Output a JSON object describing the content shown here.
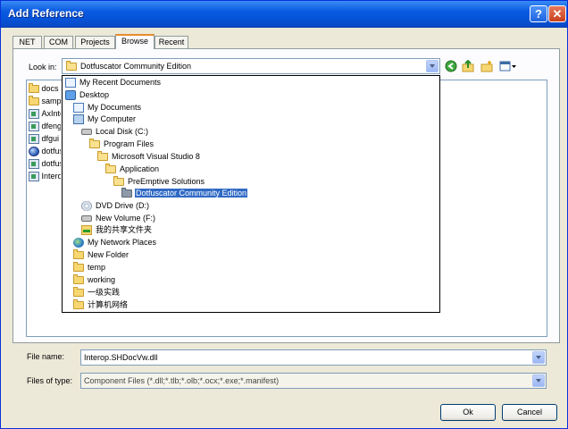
{
  "window": {
    "title": "Add Reference",
    "help_label": "?",
    "close_label": "✕"
  },
  "tabs": [
    {
      "label": "NET"
    },
    {
      "label": "COM"
    },
    {
      "label": "Projects"
    },
    {
      "label": "Browse",
      "active": true
    },
    {
      "label": "Recent"
    }
  ],
  "lookin": {
    "label": "Look in:",
    "value": "Dotfuscator Community Edition"
  },
  "toolbar": {
    "icons": [
      "back-icon",
      "up-folder-icon",
      "new-folder-icon",
      "view-menu-icon"
    ]
  },
  "files": [
    {
      "label": "docs",
      "icon": "folder"
    },
    {
      "label": "samples",
      "icon": "folder"
    },
    {
      "label": "AxInterop",
      "icon": "dll"
    },
    {
      "label": "dfeng",
      "icon": "dll"
    },
    {
      "label": "dfgui",
      "icon": "dll"
    },
    {
      "label": "dotfuscator",
      "icon": "globe"
    },
    {
      "label": "dotfuscator",
      "icon": "dll"
    },
    {
      "label": "Interop",
      "icon": "dll"
    }
  ],
  "location_dropdown": [
    {
      "label": "My Recent Documents",
      "icon": "doc"
    },
    {
      "label": "Desktop",
      "icon": "desk"
    },
    {
      "label": "My Documents",
      "icon": "doc"
    },
    {
      "label": "My Computer",
      "icon": "comp"
    },
    {
      "label": "Local Disk (C:)",
      "icon": "disk"
    },
    {
      "label": "Program Files",
      "icon": "folder-open"
    },
    {
      "label": "Microsoft Visual Studio 8",
      "icon": "folder-open"
    },
    {
      "label": "Application",
      "icon": "folder-open"
    },
    {
      "label": "PreEmptive Solutions",
      "icon": "folder-open"
    },
    {
      "label": "Dotfuscator Community Edition",
      "icon": "folder-gray",
      "selected": true
    },
    {
      "label": "DVD Drive (D:)",
      "icon": "dvd"
    },
    {
      "label": "New Volume (F:)",
      "icon": "disk"
    },
    {
      "label": "我的共享文件夹",
      "icon": "share"
    },
    {
      "label": "My Network Places",
      "icon": "net"
    },
    {
      "label": "New Folder",
      "icon": "folder"
    },
    {
      "label": "temp",
      "icon": "folder"
    },
    {
      "label": "working",
      "icon": "folder"
    },
    {
      "label": "一级实践",
      "icon": "folder"
    },
    {
      "label": "计算机网络",
      "icon": "folder"
    }
  ],
  "filename": {
    "label": "File name:",
    "value": "Interop.SHDocVw.dll"
  },
  "filetype": {
    "label": "Files of type:",
    "value": "Component Files (*.dll;*.tlb;*.olb;*.ocx;*.exe;*.manifest)"
  },
  "buttons": {
    "ok": "Ok",
    "cancel": "Cancel"
  }
}
